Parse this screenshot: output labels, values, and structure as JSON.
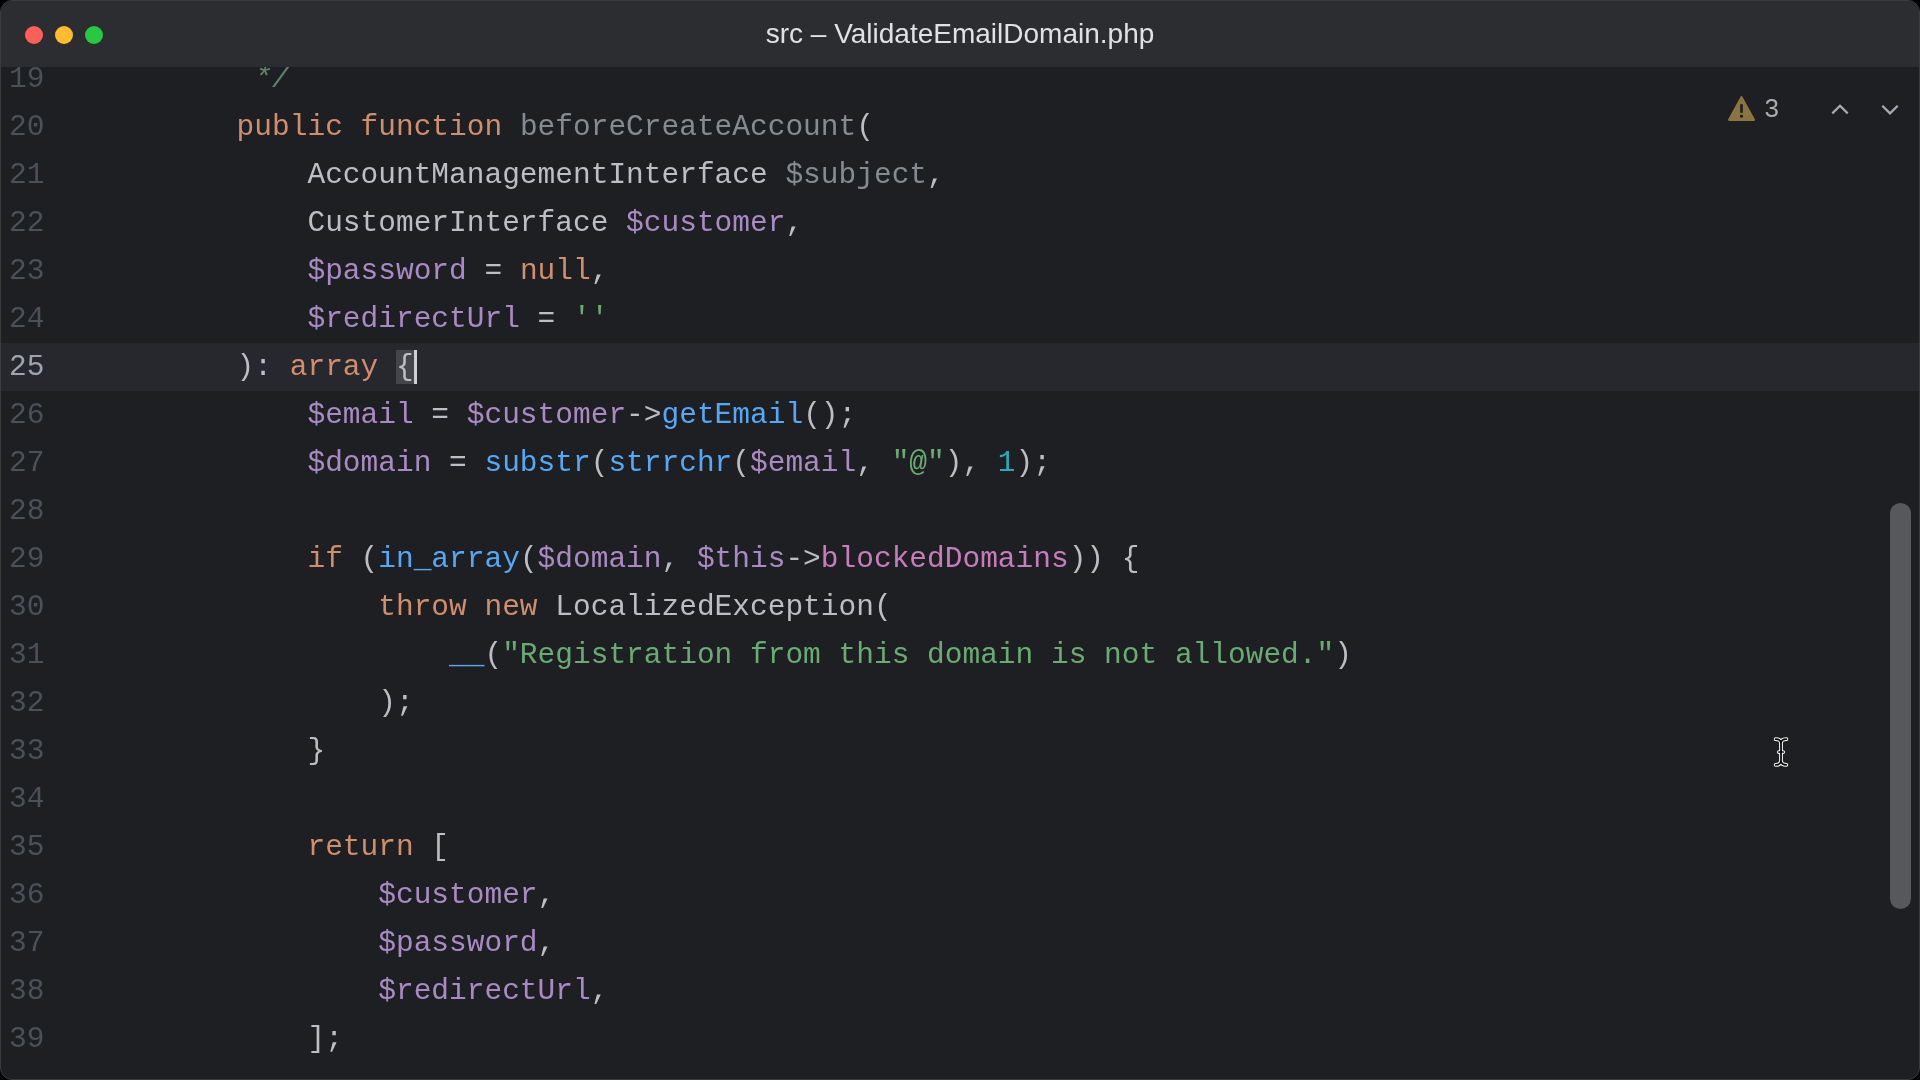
{
  "window": {
    "title": "src – ValidateEmailDomain.php"
  },
  "inspections": {
    "warning_count": "3"
  },
  "editor": {
    "lines": [
      {
        "number": "19",
        "current": false,
        "tokens": [
          {
            "kind": "comment",
            "text": "         */"
          }
        ]
      },
      {
        "number": "20",
        "current": false,
        "tokens": [
          {
            "kind": "keyword",
            "text": "        public function "
          },
          {
            "kind": "unused",
            "text": "beforeCreateAccount"
          },
          {
            "kind": "plain",
            "text": "("
          }
        ]
      },
      {
        "number": "21",
        "current": false,
        "tokens": [
          {
            "kind": "plain",
            "text": "            AccountManagementInterface "
          },
          {
            "kind": "unused",
            "text": "$subject"
          },
          {
            "kind": "plain",
            "text": ","
          }
        ]
      },
      {
        "number": "22",
        "current": false,
        "tokens": [
          {
            "kind": "plain",
            "text": "            CustomerInterface "
          },
          {
            "kind": "variable",
            "text": "$customer"
          },
          {
            "kind": "plain",
            "text": ","
          }
        ]
      },
      {
        "number": "23",
        "current": false,
        "tokens": [
          {
            "kind": "variable",
            "text": "            $password"
          },
          {
            "kind": "plain",
            "text": " = "
          },
          {
            "kind": "keyword",
            "text": "null"
          },
          {
            "kind": "plain",
            "text": ","
          }
        ]
      },
      {
        "number": "24",
        "current": false,
        "tokens": [
          {
            "kind": "variable",
            "text": "            $redirectUrl"
          },
          {
            "kind": "plain",
            "text": " = "
          },
          {
            "kind": "string",
            "text": "''"
          }
        ]
      },
      {
        "number": "25",
        "current": true,
        "tokens": [
          {
            "kind": "plain",
            "text": "        ): "
          },
          {
            "kind": "keyword",
            "text": "array "
          },
          {
            "kind": "matched-brace",
            "text": "{"
          }
        ]
      },
      {
        "number": "26",
        "current": false,
        "tokens": [
          {
            "kind": "variable",
            "text": "            $email"
          },
          {
            "kind": "plain",
            "text": " = "
          },
          {
            "kind": "variable",
            "text": "$customer"
          },
          {
            "kind": "plain",
            "text": "->"
          },
          {
            "kind": "call",
            "text": "getEmail"
          },
          {
            "kind": "plain",
            "text": "();"
          }
        ]
      },
      {
        "number": "27",
        "current": false,
        "tokens": [
          {
            "kind": "variable",
            "text": "            $domain"
          },
          {
            "kind": "plain",
            "text": " = "
          },
          {
            "kind": "call",
            "text": "substr"
          },
          {
            "kind": "plain",
            "text": "("
          },
          {
            "kind": "call",
            "text": "strrchr"
          },
          {
            "kind": "plain",
            "text": "("
          },
          {
            "kind": "variable",
            "text": "$email"
          },
          {
            "kind": "plain",
            "text": ", "
          },
          {
            "kind": "string",
            "text": "\"@\""
          },
          {
            "kind": "plain",
            "text": "), "
          },
          {
            "kind": "number",
            "text": "1"
          },
          {
            "kind": "plain",
            "text": ");"
          }
        ]
      },
      {
        "number": "28",
        "current": false
      },
      {
        "number": "29",
        "current": false,
        "tokens": [
          {
            "kind": "keyword",
            "text": "            if "
          },
          {
            "kind": "plain",
            "text": "("
          },
          {
            "kind": "call",
            "text": "in_array"
          },
          {
            "kind": "plain",
            "text": "("
          },
          {
            "kind": "variable",
            "text": "$domain"
          },
          {
            "kind": "plain",
            "text": ", "
          },
          {
            "kind": "variable",
            "text": "$this"
          },
          {
            "kind": "plain",
            "text": "->"
          },
          {
            "kind": "field",
            "text": "blockedDomains"
          },
          {
            "kind": "plain",
            "text": ")) {"
          }
        ]
      },
      {
        "number": "30",
        "current": false,
        "tokens": [
          {
            "kind": "keyword",
            "text": "                throw new "
          },
          {
            "kind": "plain",
            "text": "LocalizedException("
          }
        ]
      },
      {
        "number": "31",
        "current": false,
        "tokens": [
          {
            "kind": "call",
            "text": "                    __"
          },
          {
            "kind": "plain",
            "text": "("
          },
          {
            "kind": "string",
            "text": "\"Registration from this domain is not allowed.\""
          },
          {
            "kind": "plain",
            "text": ")"
          }
        ]
      },
      {
        "number": "32",
        "current": false,
        "tokens": [
          {
            "kind": "plain",
            "text": "                );"
          }
        ]
      },
      {
        "number": "33",
        "current": false,
        "tokens": [
          {
            "kind": "plain",
            "text": "            }"
          }
        ]
      },
      {
        "number": "34",
        "current": false
      },
      {
        "number": "35",
        "current": false,
        "tokens": [
          {
            "kind": "keyword",
            "text": "            return "
          },
          {
            "kind": "plain",
            "text": "["
          }
        ]
      },
      {
        "number": "36",
        "current": false,
        "tokens": [
          {
            "kind": "variable",
            "text": "                $customer"
          },
          {
            "kind": "plain",
            "text": ","
          }
        ]
      },
      {
        "number": "37",
        "current": false,
        "tokens": [
          {
            "kind": "variable",
            "text": "                $password"
          },
          {
            "kind": "plain",
            "text": ","
          }
        ]
      },
      {
        "number": "38",
        "current": false,
        "tokens": [
          {
            "kind": "variable",
            "text": "                $redirectUrl"
          },
          {
            "kind": "plain",
            "text": ","
          }
        ]
      },
      {
        "number": "39",
        "current": false,
        "tokens": [
          {
            "kind": "plain",
            "text": "            ];"
          }
        ]
      }
    ]
  }
}
